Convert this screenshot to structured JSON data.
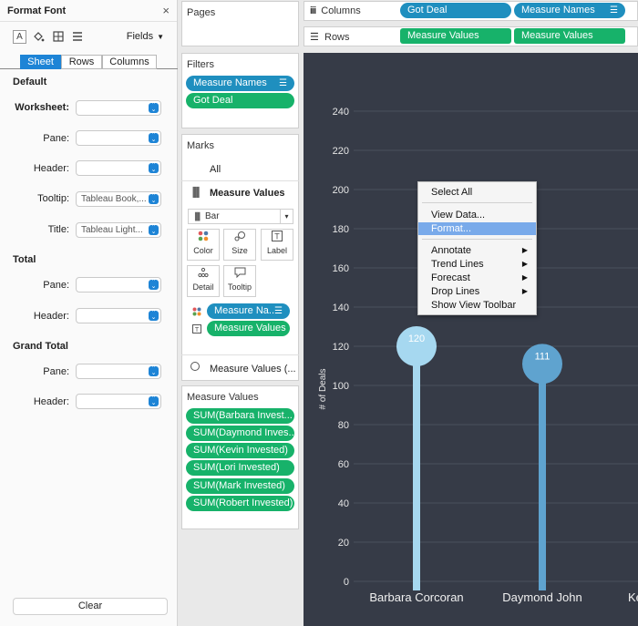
{
  "format_panel": {
    "title": "Format Font",
    "close_glyph": "×",
    "toolbar_icons": [
      "font-icon",
      "paint-bucket-icon",
      "borders-icon",
      "lines-icon"
    ],
    "fields_label": "Fields",
    "tabs": [
      "Sheet",
      "Rows",
      "Columns"
    ],
    "active_tab": "Sheet",
    "sections": [
      {
        "title": "Default"
      },
      {
        "title": "Total"
      },
      {
        "title": "Grand Total"
      }
    ],
    "rows": {
      "worksheet": {
        "label": "Worksheet:",
        "value": ""
      },
      "default_pane": {
        "label": "Pane:",
        "value": ""
      },
      "default_header": {
        "label": "Header:",
        "value": ""
      },
      "tooltip": {
        "label": "Tooltip:",
        "value": "Tableau Book,..."
      },
      "title": {
        "label": "Title:",
        "value": "Tableau Light..."
      },
      "total_pane": {
        "label": "Pane:",
        "value": ""
      },
      "total_header": {
        "label": "Header:",
        "value": ""
      },
      "grand_pane": {
        "label": "Pane:",
        "value": ""
      },
      "grand_header": {
        "label": "Header:",
        "value": ""
      }
    },
    "clear_label": "Clear"
  },
  "pages": {
    "title": "Pages"
  },
  "filters": {
    "title": "Filters",
    "pills": [
      "Measure Names",
      "Got Deal"
    ]
  },
  "marks": {
    "title": "Marks",
    "all_label": "All",
    "measure_values_label": "Measure Values",
    "mark_type": "Bar",
    "buttons": [
      "Color",
      "Size",
      "Label",
      "Detail",
      "Tooltip"
    ],
    "encodings": [
      "Measure Na..",
      "Measure Values"
    ],
    "second_card_label": "Measure Values (..."
  },
  "measure_values": {
    "title": "Measure Values",
    "pills": [
      "SUM(Barbara Invest...",
      "SUM(Daymond Inves...",
      "SUM(Kevin Invested)",
      "SUM(Lori Invested)",
      "SUM(Mark Invested)",
      "SUM(Robert Invested)"
    ]
  },
  "shelves": {
    "columns_label": "Columns",
    "columns_pills": [
      "Got Deal",
      "Measure Names"
    ],
    "rows_label": "Rows",
    "rows_pills": [
      "Measure Values",
      "Measure Values"
    ]
  },
  "context_menu": {
    "items": [
      "Select All",
      "View Data...",
      "Format...",
      "Annotate",
      "Trend Lines",
      "Forecast",
      "Drop Lines",
      "Show View Toolbar"
    ],
    "highlighted": "Format...",
    "submenu_items": [
      "Annotate",
      "Trend Lines",
      "Forecast",
      "Drop Lines"
    ]
  },
  "colors": {
    "chart_bg": "#363b47",
    "lollipop_light": "#a6d8f0",
    "lollipop_mid": "#5fa3cf",
    "accent_blue": "#1d84d6",
    "pill_green": "#17b26a",
    "pill_blue": "#1f8fbf"
  },
  "chart_data": {
    "type": "bar",
    "style": "lollipop",
    "ylabel": "# of Deals",
    "ylim": [
      0,
      240
    ],
    "yticks": [
      0,
      20,
      40,
      60,
      80,
      100,
      120,
      140,
      160,
      180,
      200,
      220,
      240
    ],
    "grid": true,
    "categories": [
      "Barbara Corcoran",
      "Daymond John",
      "Ke"
    ],
    "values": [
      120,
      111
    ],
    "data_labels": [
      "120",
      "111"
    ]
  }
}
